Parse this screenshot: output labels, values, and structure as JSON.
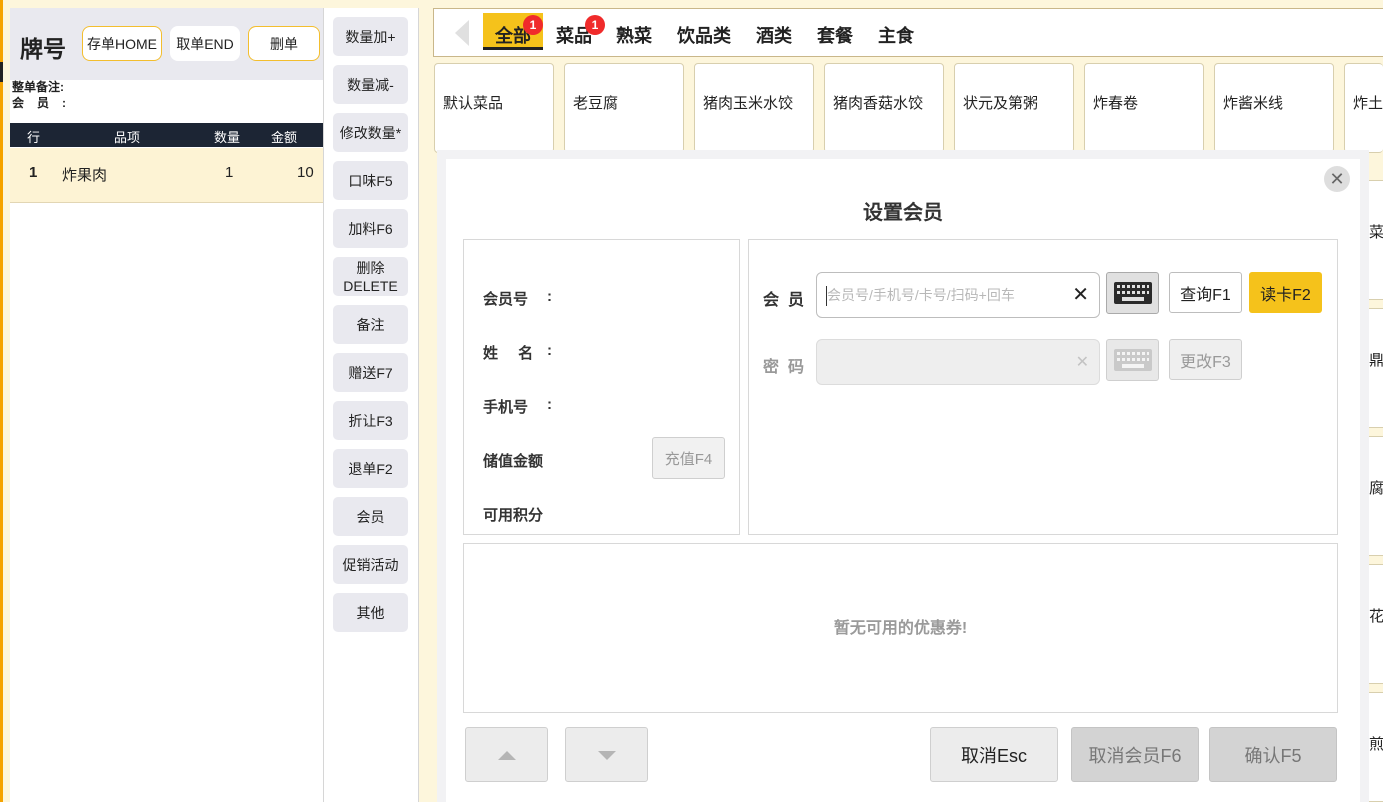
{
  "order": {
    "title": "牌号",
    "save_btn": "存单HOME",
    "retrieve_btn": "取单END",
    "delete_btn": "删单",
    "note_label": "整单备注:",
    "member_label": "会员:",
    "columns": [
      "行",
      "品项",
      "数量",
      "金额"
    ],
    "rows": [
      {
        "row": "1",
        "item": "炸果肉",
        "qty": "1",
        "amount": "10"
      }
    ]
  },
  "functions": [
    "数量加+",
    "数量减-",
    "修改数量*",
    "口味F5",
    "加料F6",
    "删除 DELETE",
    "备注",
    "赠送F7",
    "折让F3",
    "退单F2",
    "会员",
    "促销活动",
    "其他"
  ],
  "categories": {
    "items": [
      "全部",
      "菜品",
      "熟菜",
      "饮品类",
      "酒类",
      "套餐",
      "主食"
    ],
    "active": "全部",
    "badge_all": "1",
    "badge_dish": "1"
  },
  "dishes": [
    "默认菜品",
    "老豆腐",
    "猪肉玉米水饺",
    "猪肉香菇水饺",
    "状元及第粥",
    "炸春卷",
    "炸酱米线",
    "炸土"
  ],
  "side_dishes": [
    "菜",
    "鼎",
    "腐",
    "花",
    "煎"
  ],
  "modal": {
    "title": "设置会员",
    "info_labels": {
      "member_no": "会员号",
      "name": "姓 名",
      "phone": "手机号",
      "balance": "储值金额",
      "points": "可用积分",
      "colon": ":"
    },
    "recharge_btn": "充值F4",
    "member_field_label": "会员",
    "member_placeholder": "会员号/手机号/卡号/扫码+回车",
    "password_label": "密码",
    "query_btn": "查询F1",
    "read_card_btn": "读卡F2",
    "change_btn": "更改F3",
    "coupon_empty": "暂无可用的优惠券!",
    "cancel_btn": "取消Esc",
    "cancel_member_btn": "取消会员F6",
    "confirm_btn": "确认F5"
  },
  "colors": {
    "accent": "#f5c21b",
    "dark_header": "#1c2534",
    "badge": "#f02b2b"
  }
}
